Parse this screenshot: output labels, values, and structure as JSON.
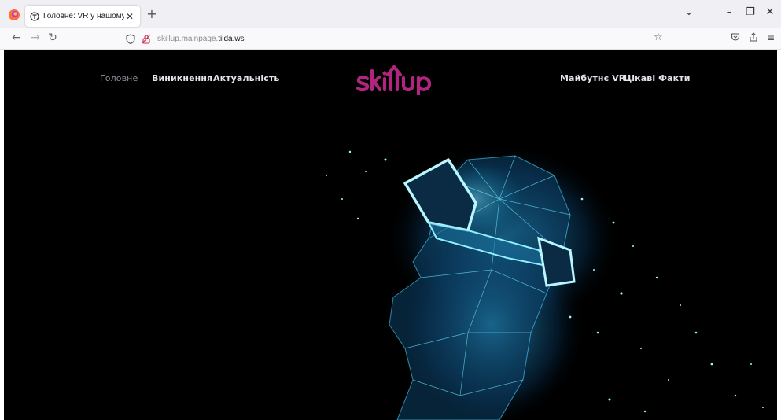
{
  "browser": {
    "tab": {
      "title": "Головне: VR у нашому житті"
    },
    "url": {
      "host_prefix": "skillup.mainpage.",
      "host_domain": "tilda.ws"
    }
  },
  "site": {
    "logo_text": "skillup",
    "nav_left": [
      {
        "label": "Головне"
      },
      {
        "label": "Виникнення"
      },
      {
        "label": "Актуальність"
      }
    ],
    "nav_right": [
      {
        "label": "Майбутнє VR"
      },
      {
        "label": "Цікаві Факти"
      }
    ],
    "colors": {
      "logo": "#b0267f",
      "hero_glow": "#48e6ff",
      "background": "#000000"
    }
  }
}
